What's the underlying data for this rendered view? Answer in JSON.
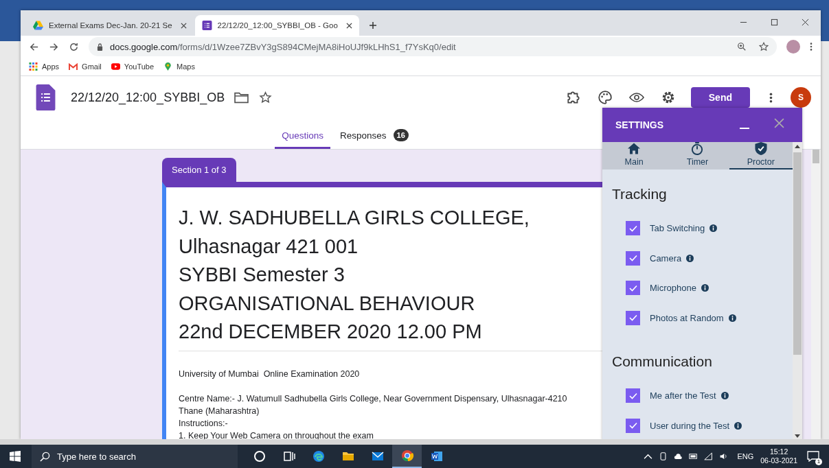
{
  "browser": {
    "tabs": [
      {
        "title": "External Exams Dec-Jan. 20-21 Se",
        "kind": "drive",
        "selected": false
      },
      {
        "title": "22/12/20_12:00_SYBBI_OB - Goo",
        "kind": "forms",
        "selected": true
      }
    ],
    "url": {
      "host": "docs.google.com",
      "path": "/forms/d/1Wzee7ZBvY3gS894CMejMA8iHoUJf9kLHhS1_f7YsKq0/edit"
    },
    "bookmarks": [
      {
        "label": "Apps",
        "kind": "apps"
      },
      {
        "label": "Gmail",
        "kind": "gmail"
      },
      {
        "label": "YouTube",
        "kind": "youtube"
      },
      {
        "label": "Maps",
        "kind": "maps"
      }
    ]
  },
  "form": {
    "doc_title": "22/12/20_12:00_SYBBI_OB",
    "send_label": "Send",
    "avatar_letter": "S",
    "tabs": [
      {
        "label": "Questions",
        "selected": true
      },
      {
        "label": "Responses",
        "badge": "16",
        "selected": false
      }
    ],
    "section_label": "Section 1 of 3",
    "title_lines": [
      "J. W. SADHUBELLA GIRLS COLLEGE,",
      "Ulhasnagar 421 001",
      "SYBBI Semester 3",
      "ORGANISATIONAL BEHAVIOUR",
      "22nd DECEMBER 2020 12.00 PM"
    ],
    "description": [
      [
        "University of Mumbai  Online Examination 2020"
      ],
      [
        "Centre Name:- J. Watumull Sadhubella Girls College, Near Government Dispensary, Ulhasnagar-4210",
        "Thane (Maharashtra)",
        "Instructions:-",
        "1. Keep Your Web Camera on throughout the exam"
      ]
    ]
  },
  "settings": {
    "title": "SETTINGS",
    "tabs": [
      {
        "label": "Main",
        "kind": "home",
        "selected": false
      },
      {
        "label": "Timer",
        "kind": "timer",
        "selected": false
      },
      {
        "label": "Proctor",
        "kind": "shield",
        "selected": true
      }
    ],
    "sections": [
      {
        "heading": "Tracking",
        "items": [
          {
            "label": "Tab Switching",
            "checked": true
          },
          {
            "label": "Camera",
            "checked": true
          },
          {
            "label": "Microphone",
            "checked": true
          },
          {
            "label": "Photos at Random",
            "checked": true
          }
        ]
      },
      {
        "heading": "Communication",
        "items": [
          {
            "label": "Me after the Test",
            "checked": true
          },
          {
            "label": "User during the Test",
            "checked": true
          }
        ]
      }
    ]
  },
  "taskbar": {
    "search_placeholder": "Type here to search",
    "apps": [
      {
        "kind": "cortana",
        "active": false
      },
      {
        "kind": "taskview",
        "active": false
      },
      {
        "kind": "edge",
        "active": false
      },
      {
        "kind": "explorer",
        "active": false
      },
      {
        "kind": "mail",
        "active": false
      },
      {
        "kind": "chrome",
        "active": true
      },
      {
        "kind": "word",
        "active": false
      }
    ],
    "language": "ENG",
    "time": "15:12",
    "date": "06-03-2021",
    "notification_count": "1"
  }
}
